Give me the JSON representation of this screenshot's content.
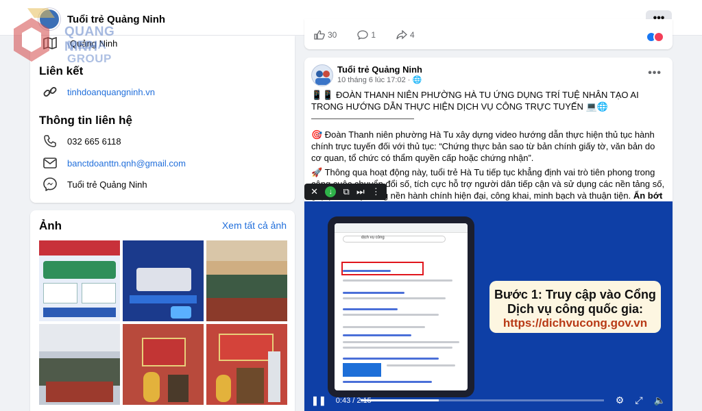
{
  "header": {
    "page_name": "Tuổi trẻ Quảng Ninh",
    "more_label": "•••"
  },
  "watermark": {
    "line1": "QUANG NINH",
    "line2": "MEDIA GROUP"
  },
  "about": {
    "location": "Quảng Ninh",
    "links_title": "Liên kết",
    "website": "tinhdoanquangninh.vn",
    "contact_title": "Thông tin liên hệ",
    "phone": "032 665 6118",
    "email": "banctdoanttn.qnh@gmail.com",
    "messenger": "Tuổi trẻ Quảng Ninh"
  },
  "photos": {
    "title": "Ảnh",
    "see_all": "Xem tất cả ảnh",
    "items": [
      {
        "name": "photo-infographic",
        "color": "#e8eef9"
      },
      {
        "name": "photo-goc-thanh-xuan",
        "color": "#1b3a8c"
      },
      {
        "name": "photo-meeting-hall",
        "color": "#c7a57a"
      },
      {
        "name": "photo-youth-meeting",
        "color": "#bfc6d1"
      },
      {
        "name": "photo-ceremony-stage",
        "color": "#b84a3c"
      },
      {
        "name": "photo-speaker-podium",
        "color": "#c2463b"
      }
    ]
  },
  "previous_post": {
    "likes": "30",
    "comments": "1",
    "shares": "4"
  },
  "post": {
    "author": "Tuổi trẻ Quảng Ninh",
    "time": "10 tháng 6 lúc 17:02 · ",
    "more": "•••",
    "headline": "📱📱 ĐOÀN THANH NIÊN PHƯỜNG HÀ TU ỨNG DỤNG TRÍ TUỆ NHÂN TẠO AI TRONG HƯỚNG DẪN THỰC HIỆN DỊCH VỤ CÔNG TRỰC TUYẾN 💻🌐",
    "para1": "🎯 Đoàn Thanh niên phường Hà Tu xây dựng video hướng dẫn thực hiện thủ tục hành chính trực tuyến đối với thủ tục: “Chứng thực bản sao từ bản chính giấy tờ, văn bản do cơ quan, tổ chức có thẩm quyền cấp hoặc chứng nhận”.",
    "para2": "🚀 Thông qua hoạt động này, tuổi trẻ Hà Tu tiếp tục khẳng định vai trò tiên phong trong công cuộc chuyển đổi số, tích cực hỗ trợ người dân tiếp cận và sử dụng các nền tảng số, góp phần xây dựng nền hành chính hiện đại, công khai, minh bạch và thuận tiện.",
    "see_less": "Ẩn bớt"
  },
  "video": {
    "step_line1": "Bước 1: Truy cập vào Cổng",
    "step_line2": "Dịch vụ công quốc gia:",
    "step_url": "https://dichvucong.gov.vn",
    "search_query": "dịch vụ công",
    "current_time": "0:43 / 2:15",
    "progress": 0.32
  }
}
